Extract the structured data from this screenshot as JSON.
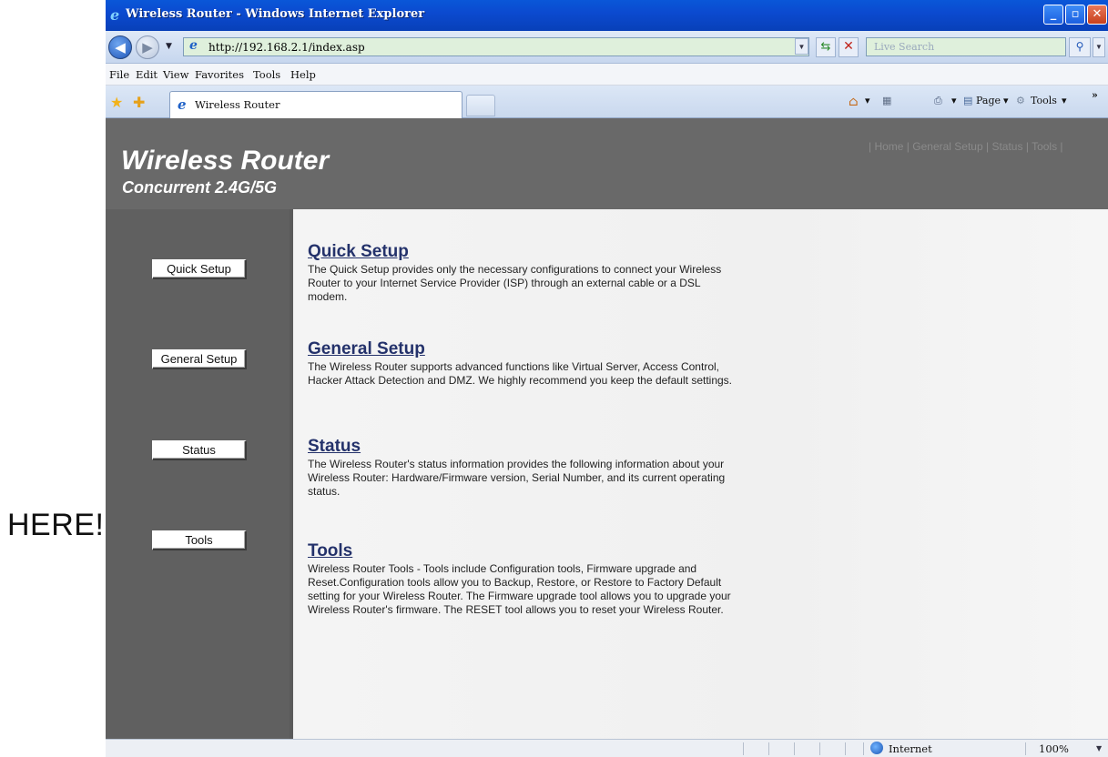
{
  "annotation": {
    "text": "HERE!"
  },
  "window": {
    "title": "Wireless Router - Windows Internet Explorer",
    "address": "http://192.168.2.1/index.asp",
    "search_placeholder": "Live Search"
  },
  "menu": {
    "items": [
      "File",
      "Edit",
      "View",
      "Favorites",
      "Tools",
      "Help"
    ]
  },
  "tab": {
    "label": "Wireless Router"
  },
  "commandbar": {
    "page": "Page",
    "tools": "Tools",
    "more": "»"
  },
  "header": {
    "title": "Wireless Router",
    "subtitle": "Concurrent 2.4G/5G",
    "topnav": [
      "Home",
      "General Setup",
      "Status",
      "Tools"
    ]
  },
  "sidebar": {
    "buttons": [
      "Quick Setup",
      "General Setup",
      "Status",
      "Tools"
    ]
  },
  "sections": [
    {
      "title": "Quick Setup",
      "text": "The Quick Setup provides only the necessary configurations to connect your Wireless Router to your Internet Service Provider (ISP) through an external cable or a DSL modem."
    },
    {
      "title": "General Setup",
      "text": "The Wireless Router supports advanced functions like Virtual Server, Access Control, Hacker Attack Detection and DMZ. We highly recommend you keep the default settings."
    },
    {
      "title": "Status",
      "text": "The Wireless Router's status information provides the following information about your Wireless Router: Hardware/Firmware version, Serial Number, and its current operating status."
    },
    {
      "title": "Tools",
      "text": "Wireless Router Tools - Tools include Configuration tools, Firmware upgrade and Reset.Configuration tools allow you to Backup, Restore, or Restore to Factory Default setting for your Wireless Router. The Firmware upgrade tool allows you to upgrade your Wireless Router's firmware. The RESET tool allows you to reset your Wireless Router."
    }
  ],
  "statusbar": {
    "zone": "Internet",
    "zoom": "100%"
  },
  "colors": {
    "titlebar": "#0b4ad0",
    "header_bg": "#696969",
    "sidebar_bg": "#606060",
    "heading_link": "#24326b"
  }
}
